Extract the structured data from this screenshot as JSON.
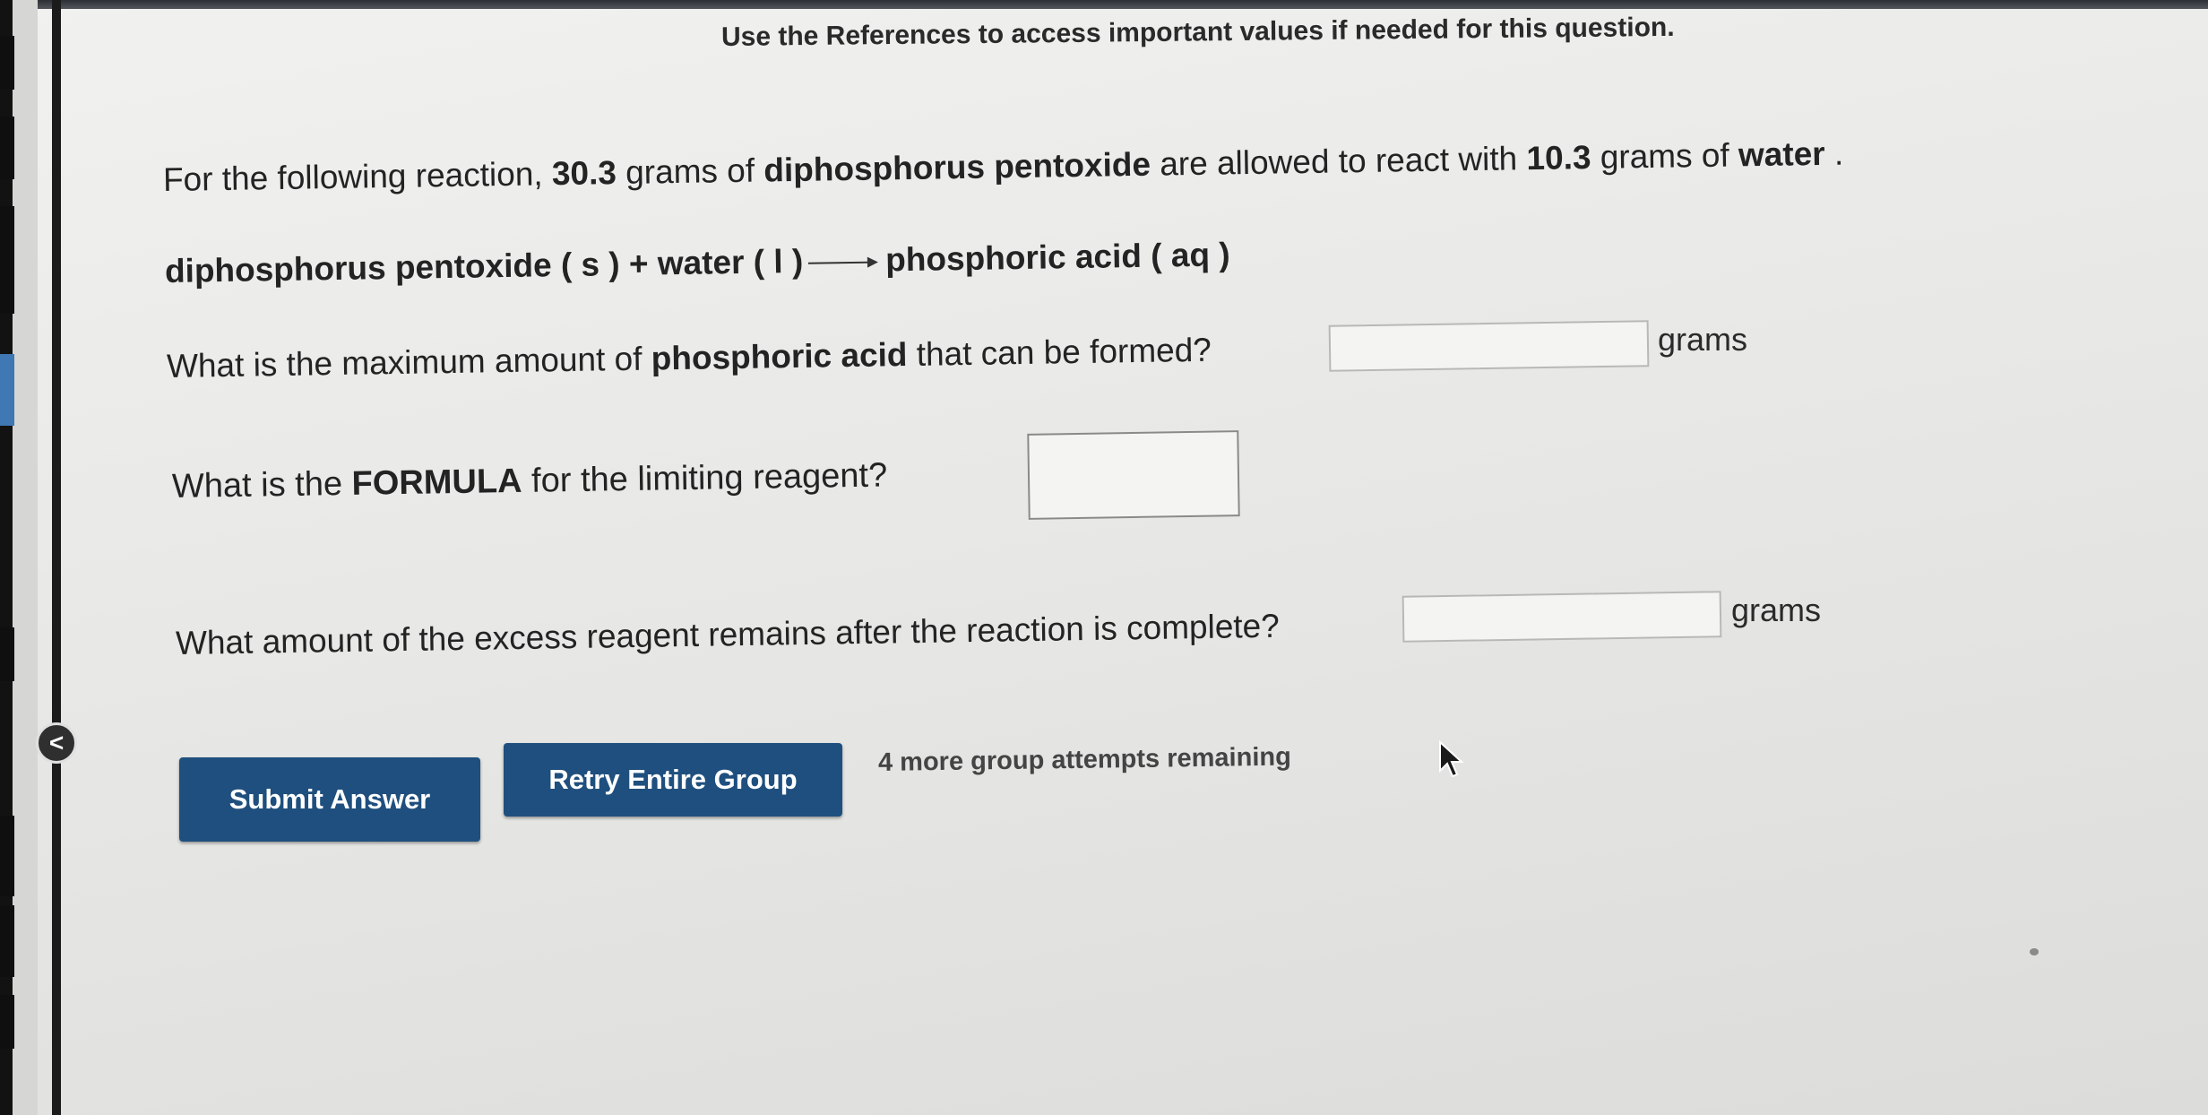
{
  "header": {
    "references_note": "Use the References to access important values if needed for this question."
  },
  "question": {
    "intro_prefix": "For the following reaction, ",
    "mass_reactant1": "30.3",
    "intro_mid1": " grams of ",
    "reactant1": "diphosphorus pentoxide",
    "intro_mid2": " are allowed to react with ",
    "mass_reactant2": "10.3",
    "intro_mid3": " grams of ",
    "reactant2": "water",
    "intro_suffix": " .",
    "equation": {
      "left": "diphosphorus pentoxide ( s ) + water ( l )",
      "right": "phosphoric acid ( aq )"
    }
  },
  "parts": {
    "q1": {
      "prefix": "What is the maximum amount of ",
      "bold": "phosphoric acid",
      "suffix": " that can be formed?",
      "value": "",
      "unit": "grams"
    },
    "q2": {
      "prefix": "What is the ",
      "bold": "FORMULA",
      "suffix": " for the limiting reagent?",
      "value": ""
    },
    "q3": {
      "text": "What amount of the excess reagent remains after the reaction is complete?",
      "value": "",
      "unit": "grams"
    }
  },
  "actions": {
    "submit_label": "Submit Answer",
    "retry_label": "Retry Entire Group",
    "attempts_text": "4 more group attempts remaining"
  },
  "sidebar": {
    "collapse_glyph": "<"
  },
  "colors": {
    "button_bg": "#1f4f7e",
    "sidebar_accent": "#3f78b3"
  }
}
